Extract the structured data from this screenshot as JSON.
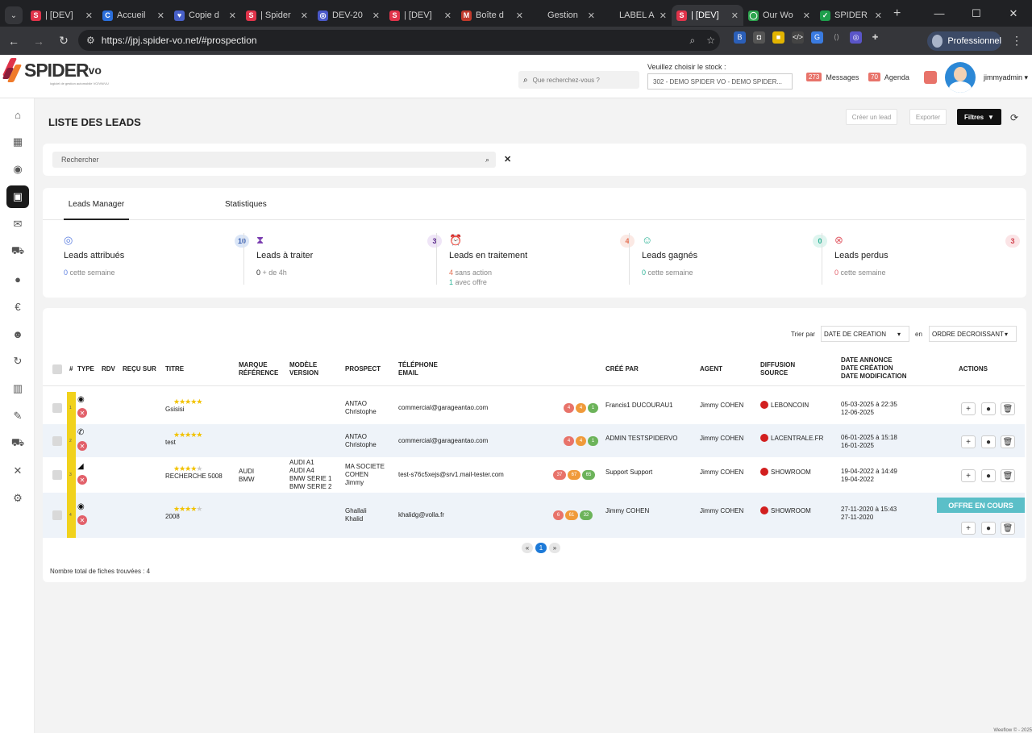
{
  "browser": {
    "tabs": [
      {
        "label": "| [DEV]",
        "color": "#e0334a",
        "glyph": "S"
      },
      {
        "label": "Accueil",
        "color": "#2a6edb",
        "glyph": "C"
      },
      {
        "label": "Copie d",
        "color": "#4860c9",
        "glyph": "♥"
      },
      {
        "label": "| Spider",
        "color": "#e0334a",
        "glyph": "S"
      },
      {
        "label": "DEV-20",
        "color": "#4a58c8",
        "glyph": "◎"
      },
      {
        "label": "| [DEV]",
        "color": "#e0334a",
        "glyph": "S"
      },
      {
        "label": "Boîte d",
        "color": "#c0392b",
        "glyph": "M"
      },
      {
        "label": "Gestion",
        "color": "#202124",
        "glyph": ""
      },
      {
        "label": "LABEL A",
        "color": "#202124",
        "glyph": ""
      },
      {
        "label": "| [DEV]",
        "color": "#e0334a",
        "glyph": "S"
      },
      {
        "label": "Our Wo",
        "color": "#2da44e",
        "glyph": "◯"
      },
      {
        "label": "SPIDER",
        "color": "#1e9e4c",
        "glyph": "✓"
      }
    ],
    "url": "https://jpj.spider-vo.net/#prospection",
    "profile_label": "Professionnel"
  },
  "header": {
    "brand_main": "SPIDER",
    "brand_suffix": "vo",
    "brand_tagline": "logiciel de gestion automobile VO/VN/VU",
    "search_placeholder": "Que recherchez-vous ?",
    "stock_label": "Veuillez choisir le stock :",
    "stock_value": "302 - DEMO SPIDER VO - DEMO SPIDER...",
    "messages_count": "273",
    "messages_label": "Messages",
    "agenda_count": "70",
    "agenda_label": "Agenda",
    "username": "jimmyadmin ▾"
  },
  "page": {
    "title": "LISTE DES LEADS",
    "create_label": "Créer un lead",
    "export_label": "Exporter",
    "filters_label": "Filtres",
    "search_placeholder": "Rechercher"
  },
  "tabs": {
    "manager": "Leads Manager",
    "stats": "Statistiques"
  },
  "kpis": [
    {
      "icon": "◎",
      "icon_color": "#5b7ee0",
      "name": "Leads attribués",
      "count": "10",
      "count_bg": "#dbe6f7",
      "count_color": "#3a5fb0",
      "l1_num": "0",
      "l1_num_color": "#5b7ee0",
      "l1_text": "cette semaine",
      "l2_num": "",
      "l2_num_color": "#5b7ee0",
      "l2_text": ""
    },
    {
      "icon": "⧗",
      "icon_color": "#7a3db0",
      "name": "Leads à traiter",
      "count": "3",
      "count_bg": "#efe5f7",
      "count_color": "#5a2a8a",
      "l1_num": "0",
      "l1_num_color": "#222",
      "l1_text": "+ de 4h",
      "l2_num": "",
      "l2_num_color": "#222",
      "l2_text": ""
    },
    {
      "icon": "⏰",
      "icon_color": "#e36f52",
      "name": "Leads en traitement",
      "count": "4",
      "count_bg": "#fbe9e4",
      "count_color": "#e36f52",
      "l1_num": "4",
      "l1_num_color": "#e36f52",
      "l1_text": "sans action",
      "l2_num": "1",
      "l2_num_color": "#2eb397",
      "l2_text": "avec offre"
    },
    {
      "icon": "☺",
      "icon_color": "#2eb397",
      "name": "Leads gagnés",
      "count": "0",
      "count_bg": "#def5ef",
      "count_color": "#2eb397",
      "l1_num": "0",
      "l1_num_color": "#2eb397",
      "l1_text": "cette semaine",
      "l2_num": "",
      "l2_num_color": "#2eb397",
      "l2_text": ""
    },
    {
      "icon": "⊗",
      "icon_color": "#e2606a",
      "name": "Leads perdus",
      "count": "3",
      "count_bg": "#fbe4e6",
      "count_color": "#d1404c",
      "l1_num": "0",
      "l1_num_color": "#e2606a",
      "l1_text": "cette semaine",
      "l2_num": "",
      "l2_num_color": "#e2606a",
      "l2_text": ""
    }
  ],
  "table": {
    "sort_label": "Trier par",
    "sort_value": "DATE DE CREATION",
    "order_label": "en",
    "order_value": "ORDRE DECROISSANT",
    "headers": {
      "hash": "#",
      "type": "TYPE",
      "rdv": "RDV",
      "recu": "REÇU SUR",
      "titre": "TITRE",
      "marque1": "MARQUE",
      "marque2": "RÉFÉRENCE",
      "modele1": "MODÈLE",
      "modele2": "VERSION",
      "prospect": "PROSPECT",
      "tel1": "TÉLÉPHONE",
      "tel2": "EMAIL",
      "cree": "CRÉÉ PAR",
      "agent": "AGENT",
      "diff1": "DIFFUSION",
      "diff2": "SOURCE",
      "date1": "DATE ANNONCE",
      "date2": "DATE CRÉATION",
      "date3": "DATE MODIFICATION",
      "actions": "ACTIONS"
    },
    "rows": [
      {
        "num": "1",
        "type_icon": "globe-icon",
        "type_glyph": "◉",
        "rating": 5,
        "titre": "Gsisisi",
        "marque": "",
        "modele": "",
        "prospect": "ANTAO\nChristophe",
        "contact": "commercial@garageantao.com",
        "circles": [
          "4",
          "4",
          "1"
        ],
        "cree": "Francis1 DUCOURAU1",
        "agent": "Jimmy COHEN",
        "source": "LEBONCOIN",
        "dates": "05-03-2025 à 22:35\n12-06-2025",
        "offer": ""
      },
      {
        "num": "2",
        "type_icon": "phone-icon",
        "type_glyph": "✆",
        "rating": 5,
        "titre": "test",
        "marque": "",
        "modele": "",
        "prospect": "ANTAO\nChristophe",
        "contact": "commercial@garageantao.com",
        "circles": [
          "4",
          "4",
          "1"
        ],
        "cree": "ADMIN TESTSPIDERVO",
        "agent": "Jimmy COHEN",
        "source": "LACENTRALE.FR",
        "dates": "06-01-2025 à 15:18\n16-01-2025",
        "offer": ""
      },
      {
        "num": "3",
        "type_icon": "megaphone-icon",
        "type_glyph": "◢",
        "rating": 4,
        "titre": "RECHERCHE 5008",
        "marque": "AUDI\nBMW",
        "modele": "AUDI A1\nAUDI A4\nBMW SERIE 1\nBMW SERIE 2",
        "prospect": "MA SOCIETE\nCOHEN\nJimmy",
        "contact": "test-s76c5xejs@srv1.mail-tester.com",
        "circles": [
          "37",
          "67",
          "65"
        ],
        "cree": "Support Support",
        "agent": "Jimmy COHEN",
        "source": "SHOWROOM",
        "dates": "19-04-2022 à 14:49\n19-04-2022",
        "offer": ""
      },
      {
        "num": "4",
        "type_icon": "globe-icon",
        "type_glyph": "◉",
        "rating": 4,
        "titre": "2008",
        "marque": "",
        "modele": "",
        "prospect": "Ghallali\nKhalid",
        "contact": "khalidg@volla.fr",
        "circles": [
          "6",
          "61",
          "32"
        ],
        "cree": "Jimmy COHEN",
        "agent": "Jimmy COHEN",
        "source": "SHOWROOM",
        "dates": "27-11-2020 à 15:43\n27-11-2020",
        "offer": "OFFRE EN COURS"
      }
    ],
    "pager": {
      "prev": "«",
      "current": "1",
      "next": "»"
    },
    "total": "Nombre total de fiches trouvées : 4"
  },
  "footer": "Weeflow © - 2025"
}
